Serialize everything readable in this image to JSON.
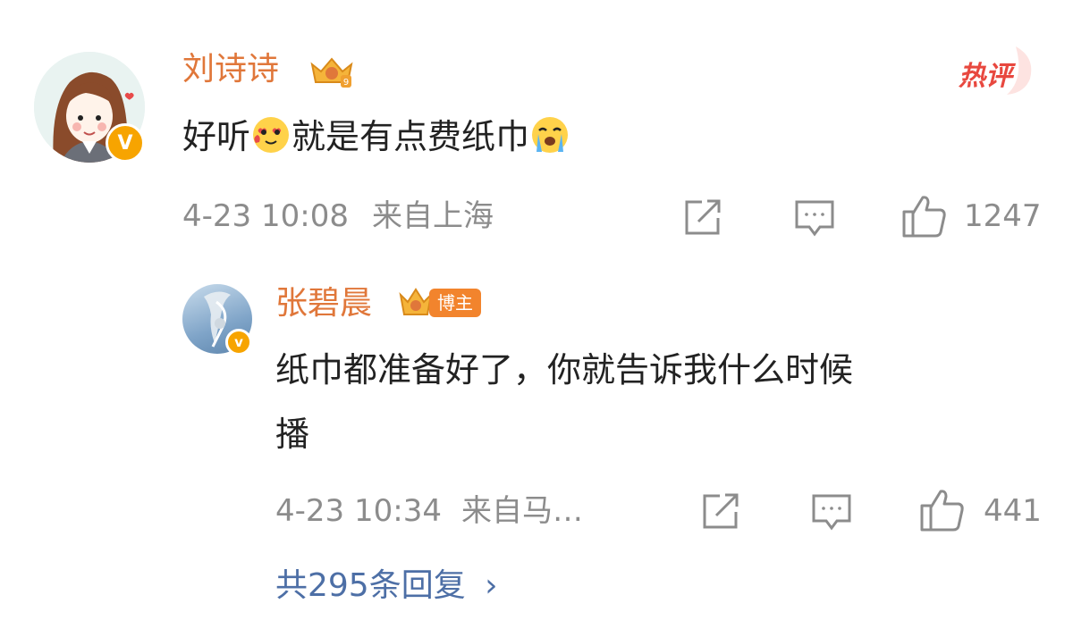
{
  "comment": {
    "author": "刘诗诗",
    "text_before_emoji": "好听",
    "text_after_emoji": "就是有点费纸巾",
    "emoji1": "heart-eyes-emoji",
    "emoji2": "crying-emoji",
    "time": "4-23 10:08",
    "location": "来自上海",
    "like_count": "1247",
    "hot_badge": "热评",
    "verified_mark": "V"
  },
  "reply": {
    "author": "张碧晨",
    "badge_label": "博主",
    "text_line1": "纸巾都准备好了，你就告诉我什么时候",
    "text_line2": "播",
    "time": "4-23 10:34",
    "location": "来自马…",
    "like_count": "441",
    "verified_mark": "v"
  },
  "more_replies": {
    "label": "共295条回复",
    "chevron": "›"
  },
  "colors": {
    "name": "#e0773a",
    "meta": "#8c8c8c",
    "link": "#4d6fa6",
    "hot": "#e8483f",
    "verified": "#f7a400"
  },
  "icons": [
    "share-icon",
    "comment-icon",
    "like-icon",
    "crown-badge-icon",
    "hot-comment-badge"
  ]
}
